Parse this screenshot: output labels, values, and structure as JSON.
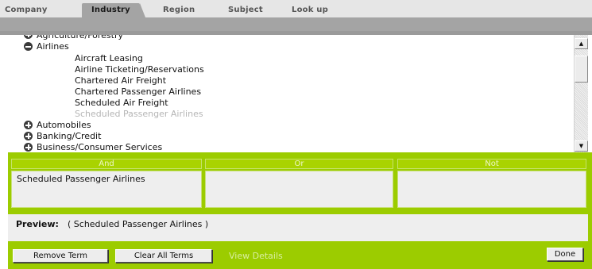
{
  "tabs": [
    {
      "label": "Company"
    },
    {
      "label": "Industry"
    },
    {
      "label": "Region"
    },
    {
      "label": "Subject"
    },
    {
      "label": "Look up"
    }
  ],
  "tree": {
    "clipped_top": "Agriculture/Forestry",
    "items": [
      {
        "label": "Airlines",
        "toggle": "minus"
      },
      {
        "label": "Aircraft Leasing"
      },
      {
        "label": "Airline Ticketing/Reservations"
      },
      {
        "label": "Chartered Air Freight"
      },
      {
        "label": "Chartered Passenger Airlines"
      },
      {
        "label": "Scheduled Air Freight"
      },
      {
        "label": "Scheduled Passenger Airlines"
      },
      {
        "label": "Automobiles",
        "toggle": "plus"
      },
      {
        "label": "Banking/Credit",
        "toggle": "plus"
      },
      {
        "label": "Business/Consumer Services",
        "toggle": "plus"
      }
    ]
  },
  "logic": {
    "and_label": "And",
    "or_label": "Or",
    "not_label": "Not",
    "and_terms": "Scheduled Passenger Airlines",
    "or_terms": "",
    "not_terms": ""
  },
  "preview": {
    "label": "Preview:",
    "value": "( Scheduled Passenger Airlines )"
  },
  "actions": {
    "remove_term": "Remove Term",
    "clear_all": "Clear All Terms",
    "view_details": "View Details",
    "done": "Done"
  },
  "colors": {
    "accent_green": "#9ccc00",
    "panel_grey": "#eeeeee",
    "tab_bar_grey": "#a4a4a4"
  }
}
